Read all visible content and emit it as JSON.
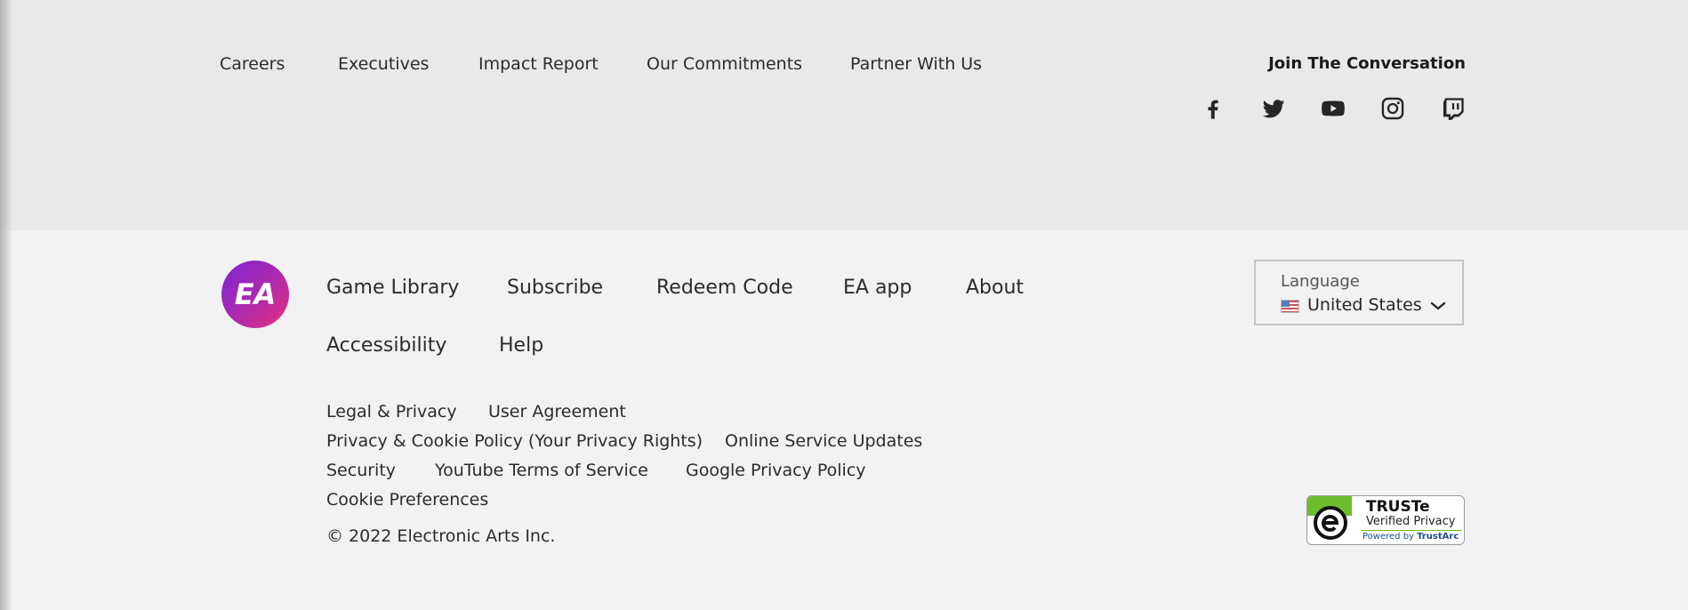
{
  "top_nav": {
    "links": [
      "Careers",
      "Executives",
      "Impact Report",
      "Our Commitments",
      "Partner With Us"
    ]
  },
  "social": {
    "title": "Join The Conversation",
    "icons": [
      "facebook-icon",
      "twitter-icon",
      "youtube-icon",
      "instagram-icon",
      "twitch-icon"
    ]
  },
  "main_nav": {
    "links": [
      "Game Library",
      "Subscribe",
      "Redeem Code",
      "EA app",
      "About",
      "Accessibility",
      "Help"
    ]
  },
  "legal": {
    "links": [
      "Legal & Privacy",
      "User Agreement",
      "Privacy & Cookie Policy (Your Privacy Rights)",
      "Online Service Updates",
      "Security",
      "YouTube Terms of Service",
      "Google Privacy Policy",
      "Cookie Preferences"
    ],
    "copyright": "© 2022 Electronic Arts Inc."
  },
  "language": {
    "label": "Language",
    "value": "United States"
  },
  "truste": {
    "title": "TRUSTe",
    "subtitle": "Verified Privacy",
    "powered_prefix": "Powered by",
    "powered_brand": "TrustArc"
  },
  "logo": {
    "text": "EA"
  },
  "colors": {
    "top_band": "#e9e9e9",
    "bottom_band": "#f2f2f2",
    "text": "#2b2b2b",
    "logo_gradient_start": "#7a24d8",
    "logo_gradient_end": "#e8307a",
    "truste_green": "#6dbe2c"
  }
}
